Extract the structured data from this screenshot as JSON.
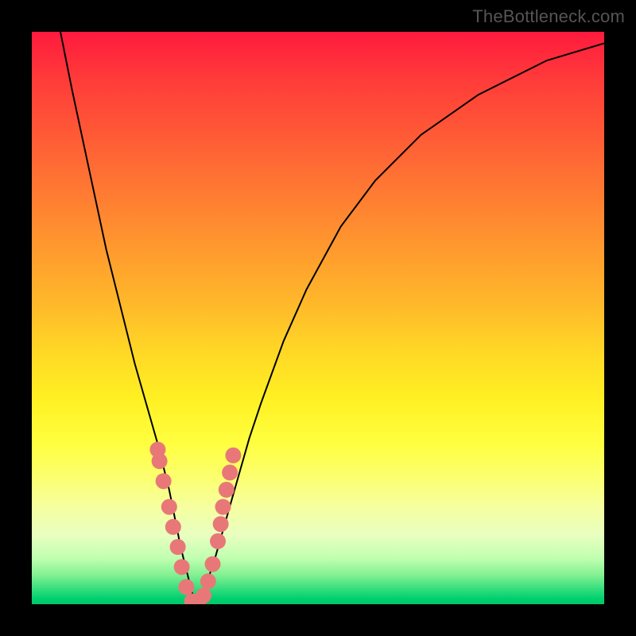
{
  "watermark": "TheBottleneck.com",
  "chart_data": {
    "type": "line",
    "title": "",
    "xlabel": "",
    "ylabel": "",
    "xlim": [
      0,
      100
    ],
    "ylim": [
      0,
      100
    ],
    "grid": false,
    "series": [
      {
        "name": "curve",
        "x": [
          5,
          7,
          10,
          13,
          16,
          18,
          20,
          22,
          24,
          25,
          26,
          27,
          28,
          29,
          30,
          32,
          34,
          36,
          38,
          40,
          44,
          48,
          54,
          60,
          68,
          78,
          90,
          100
        ],
        "y": [
          100,
          90,
          76,
          62,
          50,
          42,
          35,
          28,
          20,
          15,
          10,
          6,
          2,
          0,
          2,
          8,
          15,
          22,
          29,
          35,
          46,
          55,
          66,
          74,
          82,
          89,
          95,
          98
        ]
      }
    ],
    "markers": {
      "name": "highlight-dots",
      "color": "#e87878",
      "radius_px": 10,
      "x": [
        22.0,
        22.3,
        23.0,
        24.0,
        24.7,
        25.5,
        26.2,
        27.0,
        28.0,
        29.0,
        30.0,
        30.8,
        31.6,
        32.5,
        33.0,
        33.4,
        34.0,
        34.6,
        35.2
      ],
      "y": [
        27.0,
        25.0,
        21.5,
        17.0,
        13.5,
        10.0,
        6.5,
        3.0,
        0.5,
        0.0,
        1.5,
        4.0,
        7.0,
        11.0,
        14.0,
        17.0,
        20.0,
        23.0,
        26.0
      ]
    }
  }
}
